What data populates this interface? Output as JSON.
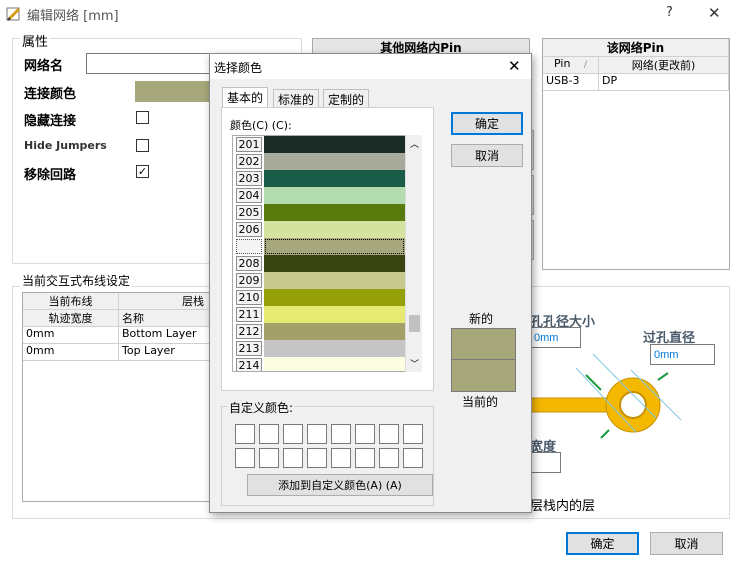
{
  "window": {
    "title": "编辑网络 [mm]",
    "help": "?",
    "close": "✕"
  },
  "properties": {
    "group_label": "属性",
    "net_name_label": "网络名",
    "net_name_value": "",
    "conn_color_label": "连接颜色",
    "conn_color_value": "#a6a77a",
    "hide_conn_label": "隐藏连接",
    "hide_conn_checked": "",
    "hide_jumpers_label": "Hide Jumpers",
    "hide_jumpers_checked": "",
    "remove_loops_label": "移除回路",
    "remove_loops_checked": "✓"
  },
  "other_net_pins": {
    "header": "其他网络内Pin"
  },
  "this_net_pins": {
    "header": "该网络Pin",
    "col_pin": "Pin",
    "col_sort": "/",
    "col_net": "网络(更改前)",
    "rows": [
      {
        "pin": "USB-3",
        "net": "DP"
      }
    ]
  },
  "routing": {
    "group_label": "当前交互式布线设定",
    "col_current": "当前布线",
    "col_layer_stack": "层栈",
    "col_width": "轨迹宽度",
    "col_name": "名称",
    "rows": [
      {
        "width": "0mm",
        "name": "Bottom Layer"
      },
      {
        "width": "0mm",
        "name": "Top Layer"
      }
    ]
  },
  "via": {
    "hole_size_label": "孔孔径大小",
    "hole_size_value": "0mm",
    "diameter_label": "过孔直径",
    "diameter_value": "0mm",
    "width_label": "宽度",
    "stack_label": "层栈内的层"
  },
  "main_buttons": {
    "ok": "确定",
    "cancel": "取消"
  },
  "color_dialog": {
    "title": "选择颜色",
    "close": "✕",
    "tabs": [
      "基本的",
      "标准的",
      "定制的"
    ],
    "colors_label": "颜色(C) (C):",
    "ok": "确定",
    "cancel": "取消",
    "new_label": "新的",
    "current_label": "当前的",
    "new_color": "#a6a77a",
    "current_color": "#a6a77a",
    "swatches": [
      {
        "num": "201",
        "color": "#1b2b25"
      },
      {
        "num": "202",
        "color": "#a8ab9b"
      },
      {
        "num": "203",
        "color": "#1b5c49"
      },
      {
        "num": "204",
        "color": "#b3dcb0"
      },
      {
        "num": "205",
        "color": "#587a0c"
      },
      {
        "num": "206",
        "color": "#d4e3a0"
      },
      {
        "num": "",
        "color": "#a6a77a"
      },
      {
        "num": "208",
        "color": "#3a4312"
      },
      {
        "num": "209",
        "color": "#c6ca8c"
      },
      {
        "num": "210",
        "color": "#959f07"
      },
      {
        "num": "211",
        "color": "#e6ea73"
      },
      {
        "num": "212",
        "color": "#a3a06a"
      },
      {
        "num": "213",
        "color": "#c5c5c5"
      },
      {
        "num": "214",
        "color": "#fcfde2"
      }
    ],
    "custom_label": "自定义颜色:",
    "add_custom": "添加到自定义颜色(A) (A)"
  },
  "colors": {
    "accent": "#0078d7",
    "via_copper": "#f5b800"
  }
}
